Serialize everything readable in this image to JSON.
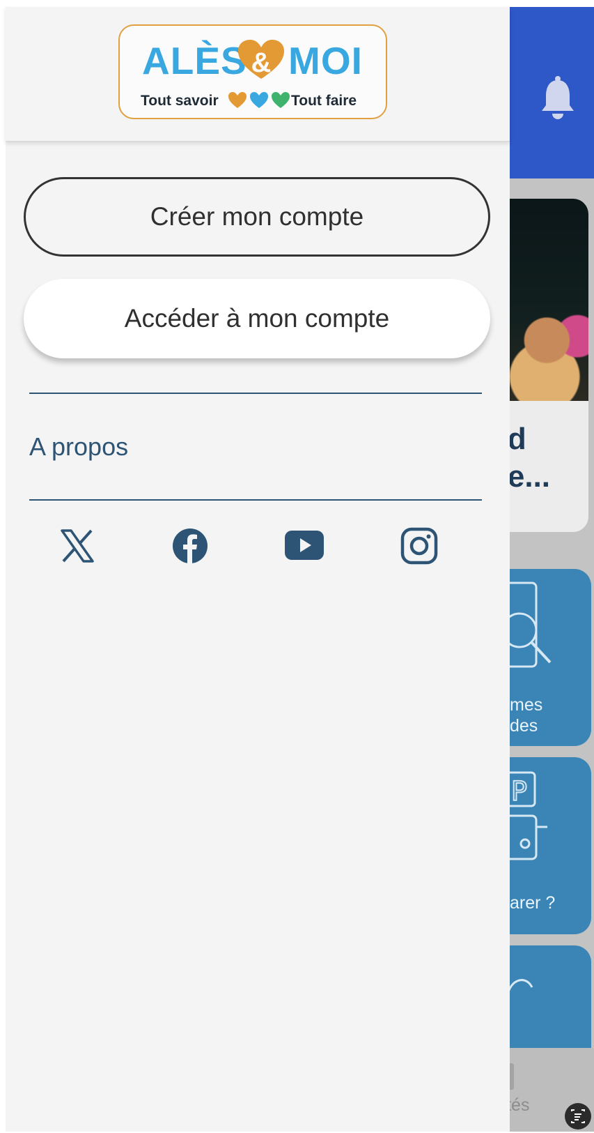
{
  "drawer": {
    "logo": {
      "word_left": "ALÈS",
      "ampersand": "&",
      "word_right": "MOI",
      "tagline_left": "Tout savoir",
      "tagline_right": "Tout faire",
      "colors": {
        "primary": "#39a7e0",
        "heart_orange": "#e39a35",
        "heart_blue": "#39a7e0",
        "heart_green": "#3fb36e",
        "border": "#e0a040"
      }
    },
    "create_account_label": "Créer mon compte",
    "access_account_label": "Accéder à mon compte",
    "about_label": "A propos",
    "social_icons": [
      "x-icon",
      "facebook-icon",
      "youtube-icon",
      "instagram-icon"
    ],
    "accent_color": "#2d5474"
  },
  "background_app": {
    "header_color": "#2e57c8",
    "header_icon": "bell-icon",
    "event_card_title_line1": "nd",
    "event_card_title_line2": "ne...",
    "tiles": [
      {
        "label_line1": "mes",
        "label_line2": "des",
        "icon": "search-document-icon"
      },
      {
        "label_line1": "arer ?",
        "icon": "parking-car-icon"
      },
      {
        "icon": "partial-icon"
      }
    ],
    "bottom_nav_label": "lités"
  }
}
